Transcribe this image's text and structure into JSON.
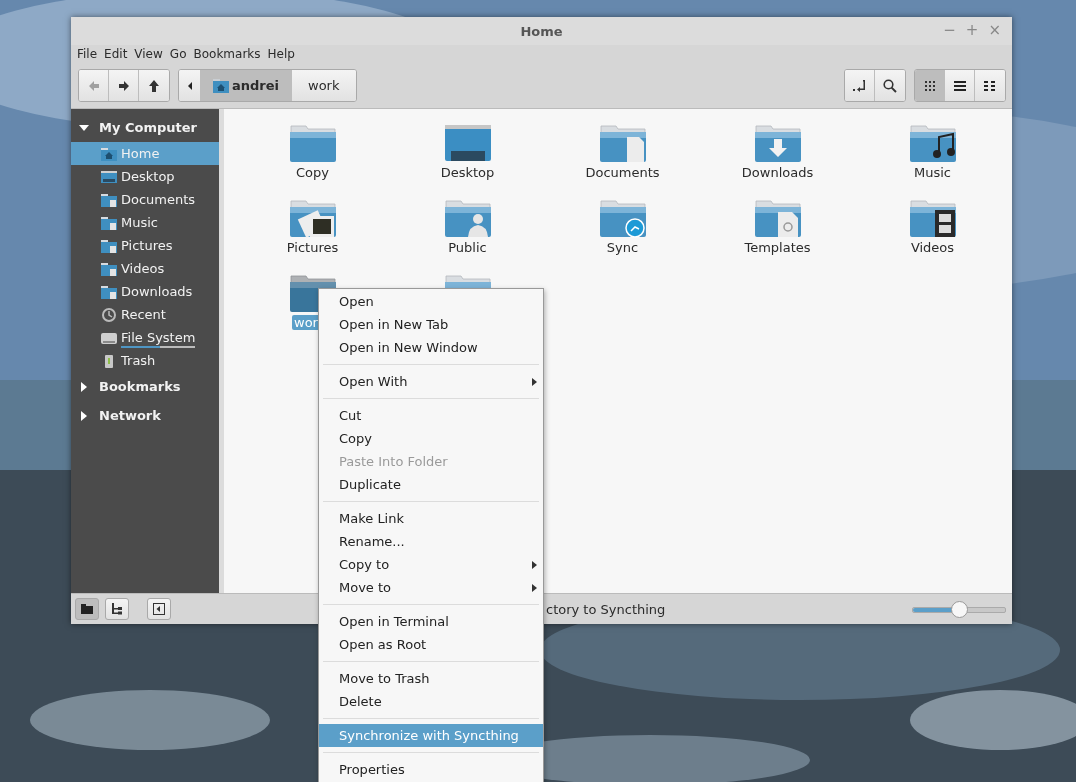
{
  "window": {
    "title": "Home",
    "controls": [
      "−",
      "+",
      "×"
    ]
  },
  "menubar": [
    "File",
    "Edit",
    "View",
    "Go",
    "Bookmarks",
    "Help"
  ],
  "toolbar": {
    "nav": [
      {
        "kind": "back",
        "disabled": true
      },
      {
        "kind": "forward",
        "disabled": false
      },
      {
        "kind": "up",
        "disabled": false
      }
    ],
    "path": [
      {
        "label": "andrei",
        "selected": true,
        "kind": "home"
      },
      {
        "label": "work",
        "selected": false,
        "kind": "folder"
      }
    ],
    "tools": [
      {
        "kind": "terminal"
      },
      {
        "kind": "search"
      }
    ],
    "views": [
      {
        "kind": "icons",
        "selected": true
      },
      {
        "kind": "list",
        "selected": false
      },
      {
        "kind": "compact",
        "selected": false
      }
    ]
  },
  "sidebar": {
    "sections": [
      {
        "title": "My Computer",
        "expanded": true,
        "items": [
          {
            "label": "Home",
            "kind": "home",
            "selected": true
          },
          {
            "label": "Desktop",
            "kind": "desktop",
            "selected": false
          },
          {
            "label": "Documents",
            "kind": "folder",
            "selected": false
          },
          {
            "label": "Music",
            "kind": "folder",
            "selected": false
          },
          {
            "label": "Pictures",
            "kind": "folder",
            "selected": false
          },
          {
            "label": "Videos",
            "kind": "folder",
            "selected": false
          },
          {
            "label": "Downloads",
            "kind": "folder",
            "selected": false
          },
          {
            "label": "Recent",
            "kind": "recent",
            "selected": false
          },
          {
            "label": "File System",
            "kind": "drive",
            "selected": false,
            "level": 0.52
          },
          {
            "label": "Trash",
            "kind": "trash",
            "selected": false
          }
        ]
      },
      {
        "title": "Bookmarks",
        "expanded": false
      },
      {
        "title": "Network",
        "expanded": false
      }
    ]
  },
  "files": [
    {
      "label": "Copy",
      "kind": "folder",
      "selected": false
    },
    {
      "label": "Desktop",
      "kind": "desktop",
      "selected": false
    },
    {
      "label": "Documents",
      "kind": "documents",
      "selected": false
    },
    {
      "label": "Downloads",
      "kind": "downloads",
      "selected": false
    },
    {
      "label": "Music",
      "kind": "music",
      "selected": false
    },
    {
      "label": "Pictures",
      "kind": "pictures",
      "selected": false
    },
    {
      "label": "Public",
      "kind": "public",
      "selected": false
    },
    {
      "label": "Sync",
      "kind": "sync",
      "selected": false
    },
    {
      "label": "Templates",
      "kind": "templates",
      "selected": false
    },
    {
      "label": "Videos",
      "kind": "videos",
      "selected": false
    },
    {
      "label": "wor",
      "kind": "folder",
      "selected": true
    },
    {
      "kind": "folder",
      "selected": false
    }
  ],
  "context_menu": {
    "groups": [
      [
        {
          "label": "Open",
          "submenu": false,
          "disabled": false,
          "selected": false
        },
        {
          "label": "Open in New Tab",
          "submenu": false,
          "disabled": false,
          "selected": false
        },
        {
          "label": "Open in New Window",
          "submenu": false,
          "disabled": false,
          "selected": false
        }
      ],
      [
        {
          "label": "Open With",
          "submenu": true,
          "disabled": false,
          "selected": false
        }
      ],
      [
        {
          "label": "Cut",
          "submenu": false,
          "disabled": false,
          "selected": false
        },
        {
          "label": "Copy",
          "submenu": false,
          "disabled": false,
          "selected": false
        },
        {
          "label": "Paste Into Folder",
          "submenu": false,
          "disabled": true,
          "selected": false
        },
        {
          "label": "Duplicate",
          "submenu": false,
          "disabled": false,
          "selected": false
        }
      ],
      [
        {
          "label": "Make Link",
          "submenu": false,
          "disabled": false,
          "selected": false
        },
        {
          "label": "Rename...",
          "submenu": false,
          "disabled": false,
          "selected": false
        },
        {
          "label": "Copy to",
          "submenu": true,
          "disabled": false,
          "selected": false
        },
        {
          "label": "Move to",
          "submenu": true,
          "disabled": false,
          "selected": false
        }
      ],
      [
        {
          "label": "Open in Terminal",
          "submenu": false,
          "disabled": false,
          "selected": false
        },
        {
          "label": "Open as Root",
          "submenu": false,
          "disabled": false,
          "selected": false
        }
      ],
      [
        {
          "label": "Move to Trash",
          "submenu": false,
          "disabled": false,
          "selected": false
        },
        {
          "label": "Delete",
          "submenu": false,
          "disabled": false,
          "selected": false
        }
      ],
      [
        {
          "label": "Synchronize with Syncthing",
          "submenu": false,
          "disabled": false,
          "selected": true
        }
      ],
      [
        {
          "label": "Properties",
          "submenu": false,
          "disabled": false,
          "selected": false
        }
      ]
    ]
  },
  "status_bar": {
    "buttons": [
      {
        "kind": "places",
        "selected": true
      },
      {
        "kind": "tree",
        "selected": false
      },
      {
        "kind": "sidebar",
        "selected": false
      }
    ],
    "text": "ctory to Syncthing",
    "zoom": {
      "level": 0.5
    }
  }
}
